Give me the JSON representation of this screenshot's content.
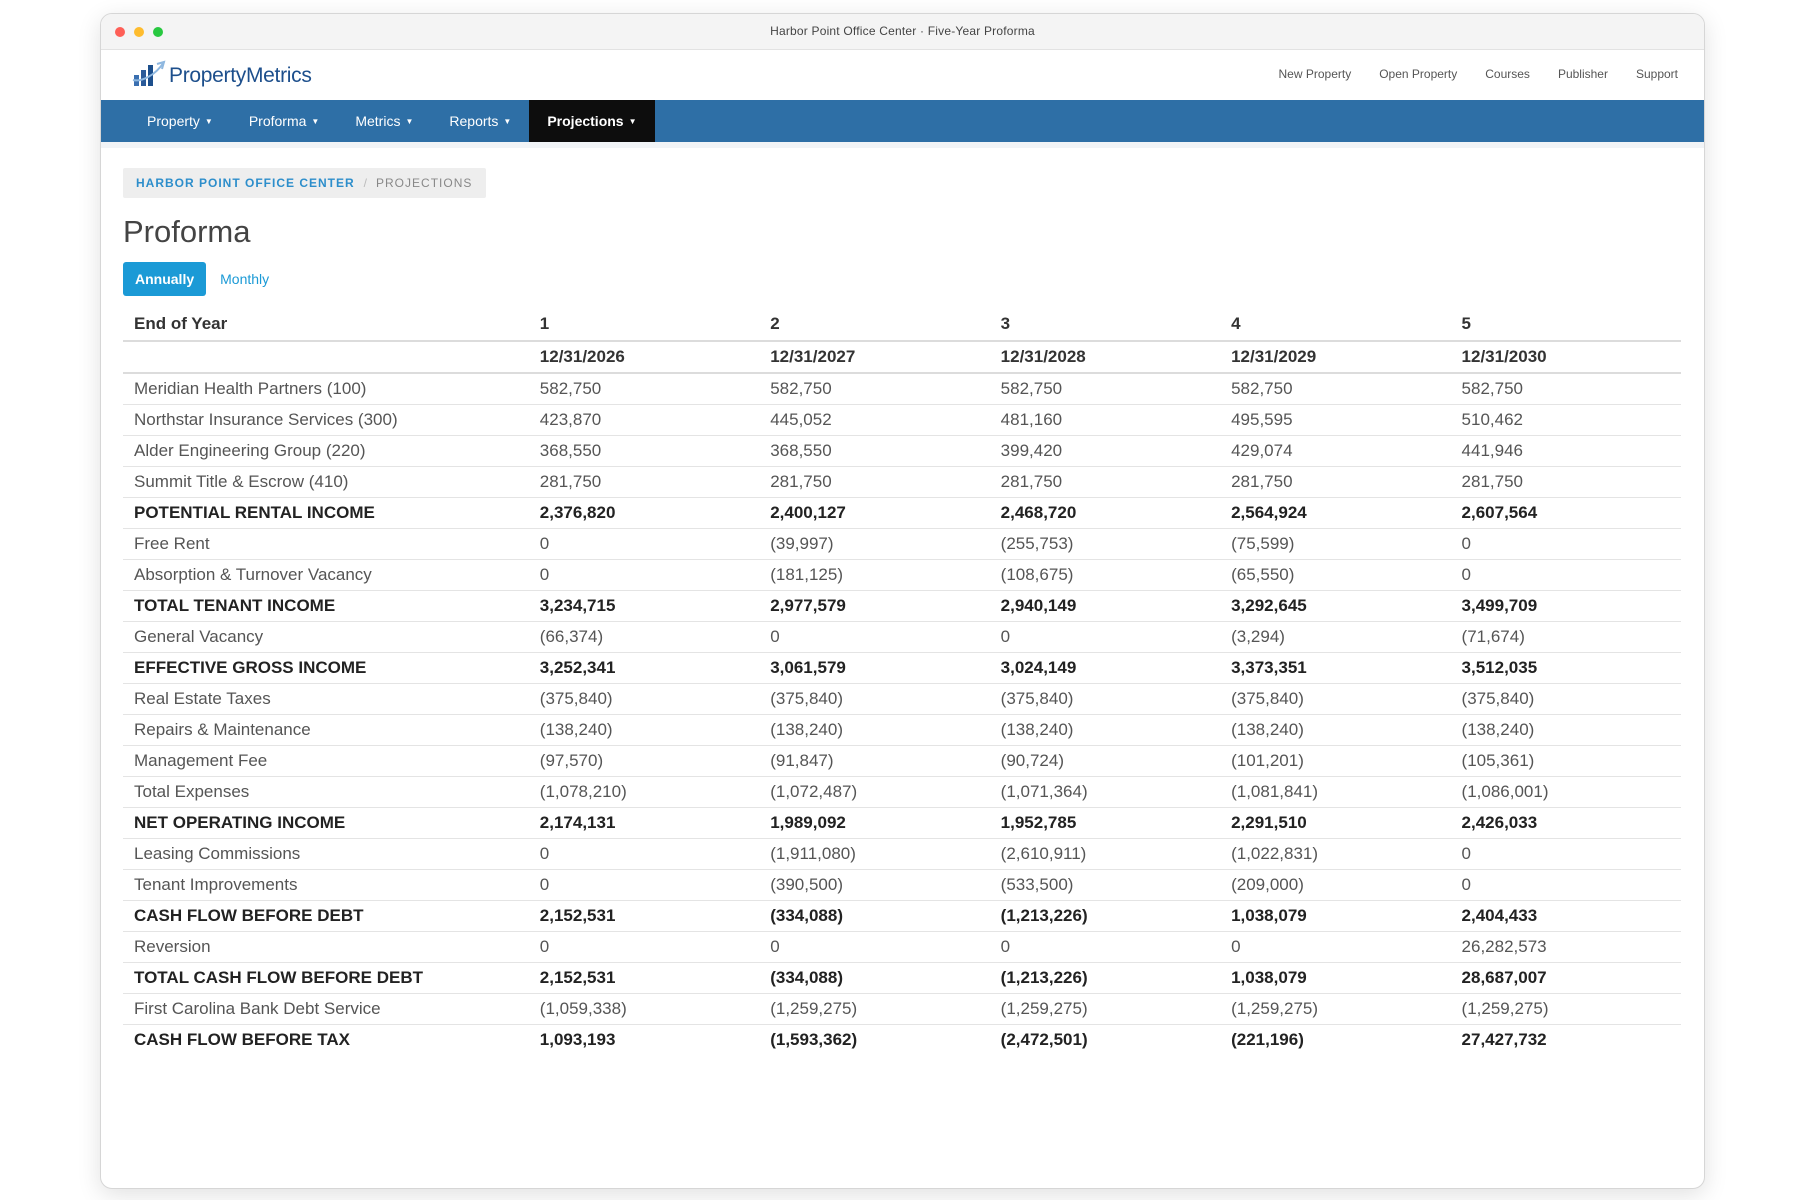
{
  "window": {
    "title": "Harbor Point Office Center · Five-Year Proforma"
  },
  "brand": {
    "name_part1": "Property",
    "name_part2": "Metrics",
    "logo_icon": "bar-chart-logo-icon"
  },
  "top_links": [
    "New Property",
    "Open Property",
    "Courses",
    "Publisher",
    "Support"
  ],
  "nav": [
    {
      "label": "Property",
      "active": false
    },
    {
      "label": "Proforma",
      "active": false
    },
    {
      "label": "Metrics",
      "active": false
    },
    {
      "label": "Reports",
      "active": false
    },
    {
      "label": "Projections",
      "active": true
    }
  ],
  "breadcrumb": {
    "link": "HARBOR POINT OFFICE CENTER",
    "separator": "/",
    "current": "PROJECTIONS"
  },
  "page_title": "Proforma",
  "toggle": {
    "annual": "Annually",
    "monthly": "Monthly",
    "selected": "Annually"
  },
  "colors": {
    "nav_bg": "#2e6fa6",
    "nav_active": "#0d0d0d",
    "accent": "#1b9ad6",
    "brand": "#1d4f8c"
  },
  "table": {
    "header_label": "End of Year",
    "years": [
      "1",
      "2",
      "3",
      "4",
      "5"
    ],
    "dates": [
      "12/31/2026",
      "12/31/2027",
      "12/31/2028",
      "12/31/2029",
      "12/31/2030"
    ],
    "rows": [
      {
        "label": "Meridian Health Partners (100)",
        "bold": false,
        "values": [
          "582,750",
          "582,750",
          "582,750",
          "582,750",
          "582,750"
        ]
      },
      {
        "label": "Northstar Insurance Services (300)",
        "bold": false,
        "values": [
          "423,870",
          "445,052",
          "481,160",
          "495,595",
          "510,462"
        ]
      },
      {
        "label": "Alder Engineering Group (220)",
        "bold": false,
        "values": [
          "368,550",
          "368,550",
          "399,420",
          "429,074",
          "441,946"
        ]
      },
      {
        "label": "Summit Title & Escrow (410)",
        "bold": false,
        "values": [
          "281,750",
          "281,750",
          "281,750",
          "281,750",
          "281,750"
        ]
      },
      {
        "label": "POTENTIAL RENTAL INCOME",
        "bold": true,
        "values": [
          "2,376,820",
          "2,400,127",
          "2,468,720",
          "2,564,924",
          "2,607,564"
        ]
      },
      {
        "label": "Free Rent",
        "bold": false,
        "values": [
          "0",
          "(39,997)",
          "(255,753)",
          "(75,599)",
          "0"
        ]
      },
      {
        "label": "Absorption & Turnover Vacancy",
        "bold": false,
        "values": [
          "0",
          "(181,125)",
          "(108,675)",
          "(65,550)",
          "0"
        ]
      },
      {
        "label": "TOTAL TENANT INCOME",
        "bold": true,
        "values": [
          "3,234,715",
          "2,977,579",
          "2,940,149",
          "3,292,645",
          "3,499,709"
        ]
      },
      {
        "label": "General Vacancy",
        "bold": false,
        "values": [
          "(66,374)",
          "0",
          "0",
          "(3,294)",
          "(71,674)"
        ]
      },
      {
        "label": "EFFECTIVE GROSS INCOME",
        "bold": true,
        "values": [
          "3,252,341",
          "3,061,579",
          "3,024,149",
          "3,373,351",
          "3,512,035"
        ]
      },
      {
        "label": "Real Estate Taxes",
        "bold": false,
        "values": [
          "(375,840)",
          "(375,840)",
          "(375,840)",
          "(375,840)",
          "(375,840)"
        ]
      },
      {
        "label": "Repairs & Maintenance",
        "bold": false,
        "values": [
          "(138,240)",
          "(138,240)",
          "(138,240)",
          "(138,240)",
          "(138,240)"
        ]
      },
      {
        "label": "Management Fee",
        "bold": false,
        "values": [
          "(97,570)",
          "(91,847)",
          "(90,724)",
          "(101,201)",
          "(105,361)"
        ]
      },
      {
        "label": "Total Expenses",
        "bold": false,
        "values": [
          "(1,078,210)",
          "(1,072,487)",
          "(1,071,364)",
          "(1,081,841)",
          "(1,086,001)"
        ]
      },
      {
        "label": "NET OPERATING INCOME",
        "bold": true,
        "values": [
          "2,174,131",
          "1,989,092",
          "1,952,785",
          "2,291,510",
          "2,426,033"
        ]
      },
      {
        "label": "Leasing Commissions",
        "bold": false,
        "values": [
          "0",
          "(1,911,080)",
          "(2,610,911)",
          "(1,022,831)",
          "0"
        ]
      },
      {
        "label": "Tenant Improvements",
        "bold": false,
        "values": [
          "0",
          "(390,500)",
          "(533,500)",
          "(209,000)",
          "0"
        ]
      },
      {
        "label": "CASH FLOW BEFORE DEBT",
        "bold": true,
        "values": [
          "2,152,531",
          "(334,088)",
          "(1,213,226)",
          "1,038,079",
          "2,404,433"
        ]
      },
      {
        "label": "Reversion",
        "bold": false,
        "values": [
          "0",
          "0",
          "0",
          "0",
          "26,282,573"
        ]
      },
      {
        "label": "TOTAL CASH FLOW BEFORE DEBT",
        "bold": true,
        "values": [
          "2,152,531",
          "(334,088)",
          "(1,213,226)",
          "1,038,079",
          "28,687,007"
        ]
      },
      {
        "label": "First Carolina Bank Debt Service",
        "bold": false,
        "values": [
          "(1,059,338)",
          "(1,259,275)",
          "(1,259,275)",
          "(1,259,275)",
          "(1,259,275)"
        ]
      },
      {
        "label": "CASH FLOW BEFORE TAX",
        "bold": true,
        "values": [
          "1,093,193",
          "(1,593,362)",
          "(2,472,501)",
          "(221,196)",
          "27,427,732"
        ]
      }
    ]
  }
}
